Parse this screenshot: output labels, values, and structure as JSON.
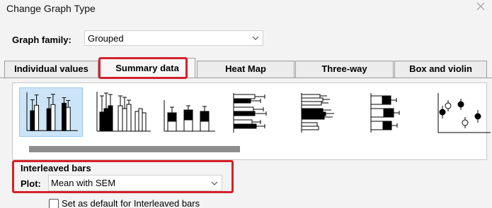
{
  "window": {
    "title": "Change Graph Type",
    "close_icon": "close-icon"
  },
  "graph_family": {
    "label": "Graph family:",
    "value": "Grouped"
  },
  "tabs": [
    {
      "label": "Individual values",
      "active": false
    },
    {
      "label": "Summary data",
      "active": true
    },
    {
      "label": "Heat Map",
      "active": false
    },
    {
      "label": "Three-way",
      "active": false
    },
    {
      "label": "Box and violin",
      "active": false
    }
  ],
  "thumbnails": [
    {
      "icon": "interleaved-bars-icon",
      "selected": true
    },
    {
      "icon": "grouped-bars-icon",
      "selected": false
    },
    {
      "icon": "stacked-bars-icon",
      "selected": false
    },
    {
      "icon": "horizontal-interleaved-bars-icon",
      "selected": false
    },
    {
      "icon": "horizontal-grouped-bars-icon",
      "selected": false
    },
    {
      "icon": "horizontal-stacked-bars-icon",
      "selected": false
    },
    {
      "icon": "grouped-scatter-icon",
      "selected": false
    }
  ],
  "section": {
    "title": "Interleaved bars",
    "plot_label": "Plot:",
    "plot_value": "Mean with SEM",
    "default_checkbox_label": "Set as default for Interleaved bars",
    "default_checked": false
  },
  "colors": {
    "highlight": "#d3222a",
    "selection": "#cce4f7",
    "background": "#f3f3f3"
  }
}
